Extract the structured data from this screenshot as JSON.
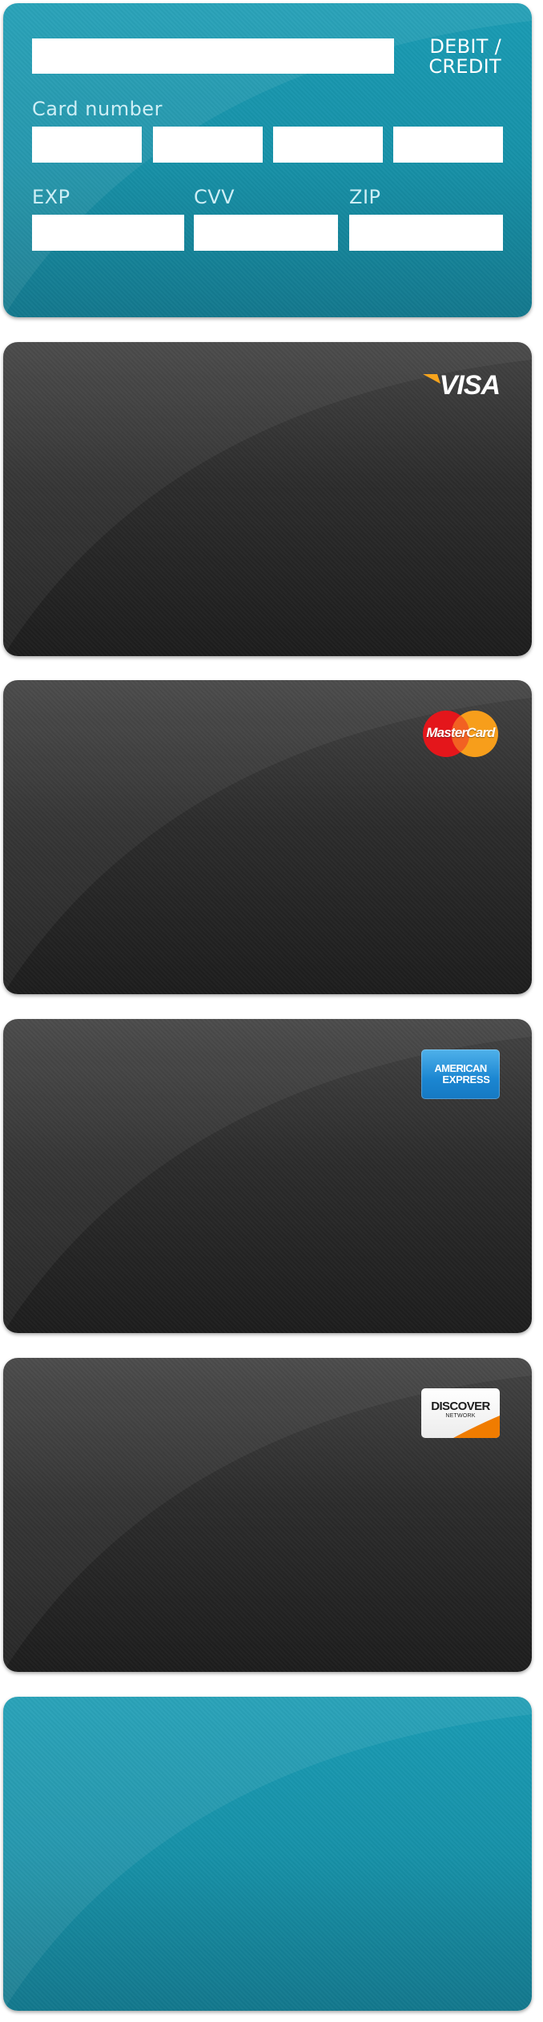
{
  "form_card": {
    "type_label_line1": "DEBIT /",
    "type_label_line2": "CREDIT",
    "name_value": "",
    "card_number_label": "Card number",
    "card_number_groups": [
      "",
      "",
      "",
      ""
    ],
    "exp_label": "EXP",
    "exp_value": "",
    "cvv_label": "CVV",
    "cvv_value": "",
    "zip_label": "ZIP",
    "zip_value": ""
  },
  "cards": [
    {
      "brand": "VISA",
      "theme": "dark",
      "logo_icon": "visa-logo-icon"
    },
    {
      "brand": "MasterCard",
      "theme": "dark",
      "logo_icon": "mastercard-logo-icon"
    },
    {
      "brand_line1": "AMERICAN",
      "brand_line2": "EXPRESS",
      "theme": "dark",
      "logo_icon": "amex-logo-icon"
    },
    {
      "brand_line1": "DISCOVER",
      "brand_line2": "NETWORK",
      "theme": "dark",
      "logo_icon": "discover-logo-icon"
    },
    {
      "theme": "teal"
    }
  ],
  "colors": {
    "teal_card": "#1791a8",
    "dark_card": "#2c2c2c",
    "visa_accent": "#f7a41d",
    "mastercard_red": "#e4161b",
    "mastercard_orange": "#f79e1b",
    "amex_blue": "#1b86d1",
    "discover_orange": "#f07c00"
  }
}
